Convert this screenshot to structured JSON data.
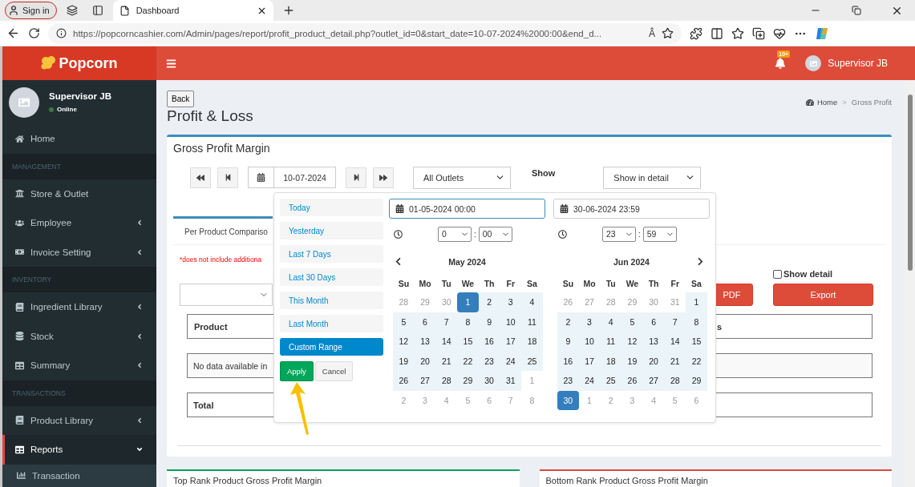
{
  "browser": {
    "profile": "Sign in",
    "tab_title": "Dashboard",
    "url": "https://popcorncashier.com/Admin/pages/report/profit_product_detail.php?outlet_id=0&start_date=10-07-2024%2000:00&end_d...",
    "read_aloud": "Â"
  },
  "header": {
    "brand": "Popcorn",
    "notification_badge": "10+",
    "user": "Supervisor JB"
  },
  "sidebar": {
    "user": {
      "name": "Supervisor JB",
      "status": "Online",
      "online": true
    },
    "items": [
      {
        "kind": "link",
        "label": "Home",
        "selected": false
      },
      {
        "kind": "header",
        "label": "MANAGEMENT"
      },
      {
        "kind": "link",
        "label": "Store & Outlet",
        "selected": false
      },
      {
        "kind": "menu",
        "label": "Employee",
        "selected": false,
        "expanded": false
      },
      {
        "kind": "menu",
        "label": "Invoice Setting",
        "selected": false,
        "expanded": false
      },
      {
        "kind": "header",
        "label": "INVENTORY"
      },
      {
        "kind": "menu",
        "label": "Ingredient Library",
        "selected": false,
        "expanded": false
      },
      {
        "kind": "menu",
        "label": "Stock",
        "selected": false,
        "expanded": false
      },
      {
        "kind": "menu",
        "label": "Summary",
        "selected": false,
        "expanded": false
      },
      {
        "kind": "header",
        "label": "TRANSACTIONS"
      },
      {
        "kind": "menu",
        "label": "Product Library",
        "selected": false,
        "expanded": false
      },
      {
        "kind": "menu",
        "label": "Reports",
        "selected": true,
        "expanded": true
      },
      {
        "kind": "sub",
        "label": "Transaction",
        "selected": false
      }
    ]
  },
  "page": {
    "back": "Back",
    "title": "Profit & Loss",
    "breadcrumb": [
      "Home",
      "Gross Profit"
    ],
    "separator": ">"
  },
  "report": {
    "title": "Gross Profit Margin",
    "date": "10-07-2024",
    "outlet": "All Outlets",
    "show_label": "Show",
    "show_value": "Show in detail",
    "tab": "Per Product Compariso",
    "note": "*does not include additiona",
    "show_detail": {
      "label": "Show detail",
      "checked": false
    },
    "buttons": [
      "PDF",
      "Export"
    ],
    "columns": [
      "Product",
      "s"
    ],
    "empty": "No data available in",
    "total": "Total"
  },
  "date_picker": {
    "presets": [
      {
        "label": "Today",
        "selected": false
      },
      {
        "label": "Yesterday",
        "selected": false
      },
      {
        "label": "Last 7 Days",
        "selected": false
      },
      {
        "label": "Last 30 Days",
        "selected": false
      },
      {
        "label": "This Month",
        "selected": false
      },
      {
        "label": "Last Month",
        "selected": false
      },
      {
        "label": "Custom Range",
        "selected": true
      }
    ],
    "apply": "Apply",
    "cancel": "Cancel",
    "time_separator": ":",
    "calendars": [
      {
        "value": "01-05-2024 00:00",
        "focused": true,
        "hour": "0",
        "minute": "00",
        "title": "May 2024",
        "weekdays": [
          "Su",
          "Mo",
          "Tu",
          "We",
          "Th",
          "Fr",
          "Sa"
        ],
        "weeks": [
          [
            {
              "d": "28",
              "kind": "off"
            },
            {
              "d": "29",
              "kind": "off"
            },
            {
              "d": "30",
              "kind": "off"
            },
            {
              "d": "1",
              "kind": "start"
            },
            {
              "d": "2",
              "kind": "in"
            },
            {
              "d": "3",
              "kind": "in"
            },
            {
              "d": "4",
              "kind": "in"
            }
          ],
          [
            {
              "d": "5",
              "kind": "in"
            },
            {
              "d": "6",
              "kind": "in"
            },
            {
              "d": "7",
              "kind": "in"
            },
            {
              "d": "8",
              "kind": "in"
            },
            {
              "d": "9",
              "kind": "in"
            },
            {
              "d": "10",
              "kind": "in"
            },
            {
              "d": "11",
              "kind": "in"
            }
          ],
          [
            {
              "d": "12",
              "kind": "in"
            },
            {
              "d": "13",
              "kind": "in"
            },
            {
              "d": "14",
              "kind": "in"
            },
            {
              "d": "15",
              "kind": "in"
            },
            {
              "d": "16",
              "kind": "in"
            },
            {
              "d": "17",
              "kind": "in"
            },
            {
              "d": "18",
              "kind": "in"
            }
          ],
          [
            {
              "d": "19",
              "kind": "in"
            },
            {
              "d": "20",
              "kind": "in"
            },
            {
              "d": "21",
              "kind": "in"
            },
            {
              "d": "22",
              "kind": "in"
            },
            {
              "d": "23",
              "kind": "in"
            },
            {
              "d": "24",
              "kind": "in"
            },
            {
              "d": "25",
              "kind": "in"
            }
          ],
          [
            {
              "d": "26",
              "kind": "in"
            },
            {
              "d": "27",
              "kind": "in"
            },
            {
              "d": "28",
              "kind": "in"
            },
            {
              "d": "29",
              "kind": "in"
            },
            {
              "d": "30",
              "kind": "in"
            },
            {
              "d": "31",
              "kind": "in"
            },
            {
              "d": "1",
              "kind": "off"
            }
          ],
          [
            {
              "d": "2",
              "kind": "off"
            },
            {
              "d": "3",
              "kind": "off"
            },
            {
              "d": "4",
              "kind": "off"
            },
            {
              "d": "5",
              "kind": "off"
            },
            {
              "d": "6",
              "kind": "off"
            },
            {
              "d": "7",
              "kind": "off"
            },
            {
              "d": "8",
              "kind": "off"
            }
          ]
        ]
      },
      {
        "value": "30-06-2024 23:59",
        "focused": false,
        "hour": "23",
        "minute": "59",
        "title": "Jun 2024",
        "weekdays": [
          "Su",
          "Mo",
          "Tu",
          "We",
          "Th",
          "Fr",
          "Sa"
        ],
        "weeks": [
          [
            {
              "d": "26",
              "kind": "off"
            },
            {
              "d": "27",
              "kind": "off"
            },
            {
              "d": "28",
              "kind": "off"
            },
            {
              "d": "29",
              "kind": "off"
            },
            {
              "d": "30",
              "kind": "off"
            },
            {
              "d": "31",
              "kind": "off"
            },
            {
              "d": "1",
              "kind": "in"
            }
          ],
          [
            {
              "d": "2",
              "kind": "in"
            },
            {
              "d": "3",
              "kind": "in"
            },
            {
              "d": "4",
              "kind": "in"
            },
            {
              "d": "5",
              "kind": "in"
            },
            {
              "d": "6",
              "kind": "in"
            },
            {
              "d": "7",
              "kind": "in"
            },
            {
              "d": "8",
              "kind": "in"
            }
          ],
          [
            {
              "d": "9",
              "kind": "in"
            },
            {
              "d": "10",
              "kind": "in"
            },
            {
              "d": "11",
              "kind": "in"
            },
            {
              "d": "12",
              "kind": "in"
            },
            {
              "d": "13",
              "kind": "in"
            },
            {
              "d": "14",
              "kind": "in"
            },
            {
              "d": "15",
              "kind": "in"
            }
          ],
          [
            {
              "d": "16",
              "kind": "in"
            },
            {
              "d": "17",
              "kind": "in"
            },
            {
              "d": "18",
              "kind": "in"
            },
            {
              "d": "19",
              "kind": "in"
            },
            {
              "d": "20",
              "kind": "in"
            },
            {
              "d": "21",
              "kind": "in"
            },
            {
              "d": "22",
              "kind": "in"
            }
          ],
          [
            {
              "d": "23",
              "kind": "in"
            },
            {
              "d": "24",
              "kind": "in"
            },
            {
              "d": "25",
              "kind": "in"
            },
            {
              "d": "26",
              "kind": "in"
            },
            {
              "d": "27",
              "kind": "in"
            },
            {
              "d": "28",
              "kind": "in"
            },
            {
              "d": "29",
              "kind": "in"
            }
          ],
          [
            {
              "d": "30",
              "kind": "end"
            },
            {
              "d": "1",
              "kind": "off"
            },
            {
              "d": "2",
              "kind": "off"
            },
            {
              "d": "3",
              "kind": "off"
            },
            {
              "d": "4",
              "kind": "off"
            },
            {
              "d": "5",
              "kind": "off"
            },
            {
              "d": "6",
              "kind": "off"
            }
          ]
        ]
      }
    ]
  },
  "cards": [
    {
      "title": "Top Rank Product Gross Profit Margin",
      "color": "#00a65a"
    },
    {
      "title": "Bottom Rank Product Gross Profit Margin",
      "color": "#dd4b39"
    }
  ]
}
